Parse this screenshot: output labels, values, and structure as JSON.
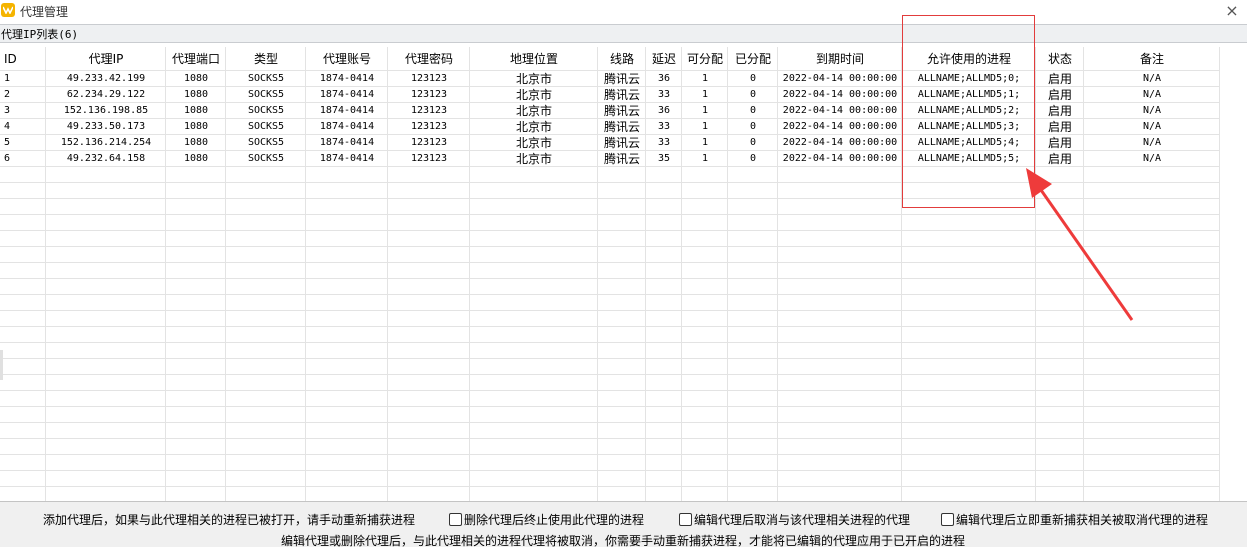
{
  "window": {
    "title": "代理管理",
    "close_glyph": "×"
  },
  "list_caption": "代理IP列表(6)",
  "table": {
    "columns": [
      "ID",
      "代理IP",
      "代理端口",
      "类型",
      "代理账号",
      "代理密码",
      "地理位置",
      "线路",
      "延迟",
      "可分配",
      "已分配",
      "到期时间",
      "允许使用的进程",
      "状态",
      "备注"
    ],
    "rows": [
      [
        "1",
        "49.233.42.199",
        "1080",
        "SOCKS5",
        "1874-0414",
        "123123",
        "北京市",
        "腾讯云",
        "36",
        "1",
        "0",
        "2022-04-14 00:00:00",
        "ALLNAME;ALLMD5;0;",
        "启用",
        "N/A"
      ],
      [
        "2",
        "62.234.29.122",
        "1080",
        "SOCKS5",
        "1874-0414",
        "123123",
        "北京市",
        "腾讯云",
        "33",
        "1",
        "0",
        "2022-04-14 00:00:00",
        "ALLNAME;ALLMD5;1;",
        "启用",
        "N/A"
      ],
      [
        "3",
        "152.136.198.85",
        "1080",
        "SOCKS5",
        "1874-0414",
        "123123",
        "北京市",
        "腾讯云",
        "36",
        "1",
        "0",
        "2022-04-14 00:00:00",
        "ALLNAME;ALLMD5;2;",
        "启用",
        "N/A"
      ],
      [
        "4",
        "49.233.50.173",
        "1080",
        "SOCKS5",
        "1874-0414",
        "123123",
        "北京市",
        "腾讯云",
        "33",
        "1",
        "0",
        "2022-04-14 00:00:00",
        "ALLNAME;ALLMD5;3;",
        "启用",
        "N/A"
      ],
      [
        "5",
        "152.136.214.254",
        "1080",
        "SOCKS5",
        "1874-0414",
        "123123",
        "北京市",
        "腾讯云",
        "33",
        "1",
        "0",
        "2022-04-14 00:00:00",
        "ALLNAME;ALLMD5;4;",
        "启用",
        "N/A"
      ],
      [
        "6",
        "49.232.64.158",
        "1080",
        "SOCKS5",
        "1874-0414",
        "123123",
        "北京市",
        "腾讯云",
        "35",
        "1",
        "0",
        "2022-04-14 00:00:00",
        "ALLNAME;ALLMD5;5;",
        "启用",
        "N/A"
      ]
    ]
  },
  "footer": {
    "note_add": "添加代理后，如果与此代理相关的进程已被打开，请手动重新捕获进程",
    "opt_delete": "删除代理后终止使用此代理的进程",
    "opt_edit_cancel": "编辑代理后取消与该代理相关进程的代理",
    "opt_edit_recapture": "编辑代理后立即重新捕获相关被取消代理的进程",
    "note_bottom": "编辑代理或删除代理后，与此代理相关的进程代理将被取消，你需要手动重新捕获进程，才能将已编辑的代理应用于已开启的进程"
  },
  "annotation": {
    "highlight_color": "#e23c3c"
  }
}
